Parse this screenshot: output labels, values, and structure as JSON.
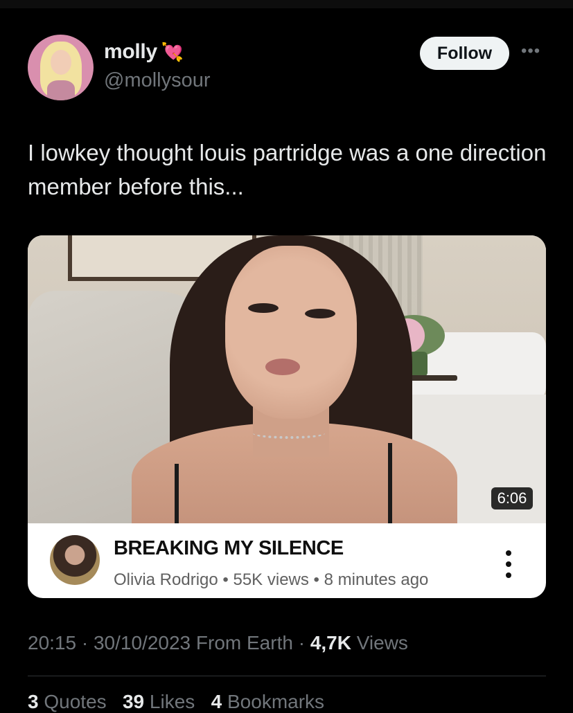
{
  "author": {
    "name": "molly",
    "emoji_icon": "heart-with-arrow-icon",
    "handle": "@mollysour"
  },
  "follow_label": "Follow",
  "more_icon": "more-horizontal-icon",
  "tweet_text": "I lowkey thought louis partridge was a one direction member before this...",
  "video_card": {
    "duration": "6:06",
    "title": "BREAKING MY SILENCE",
    "channel": "Olivia Rodrigo",
    "views": "55K views",
    "age": "8 minutes ago"
  },
  "meta": {
    "time": "20:15",
    "date": "30/10/2023",
    "source": "From Earth",
    "views_count": "4,7K",
    "views_label": "Views"
  },
  "stats": {
    "quotes_count": "3",
    "quotes_label": "Quotes",
    "likes_count": "39",
    "likes_label": "Likes",
    "bookmarks_count": "4",
    "bookmarks_label": "Bookmarks"
  },
  "colors": {
    "background": "#000000",
    "text": "#e7e9ea",
    "muted": "#71767b",
    "follow_bg": "#eff3f4"
  }
}
